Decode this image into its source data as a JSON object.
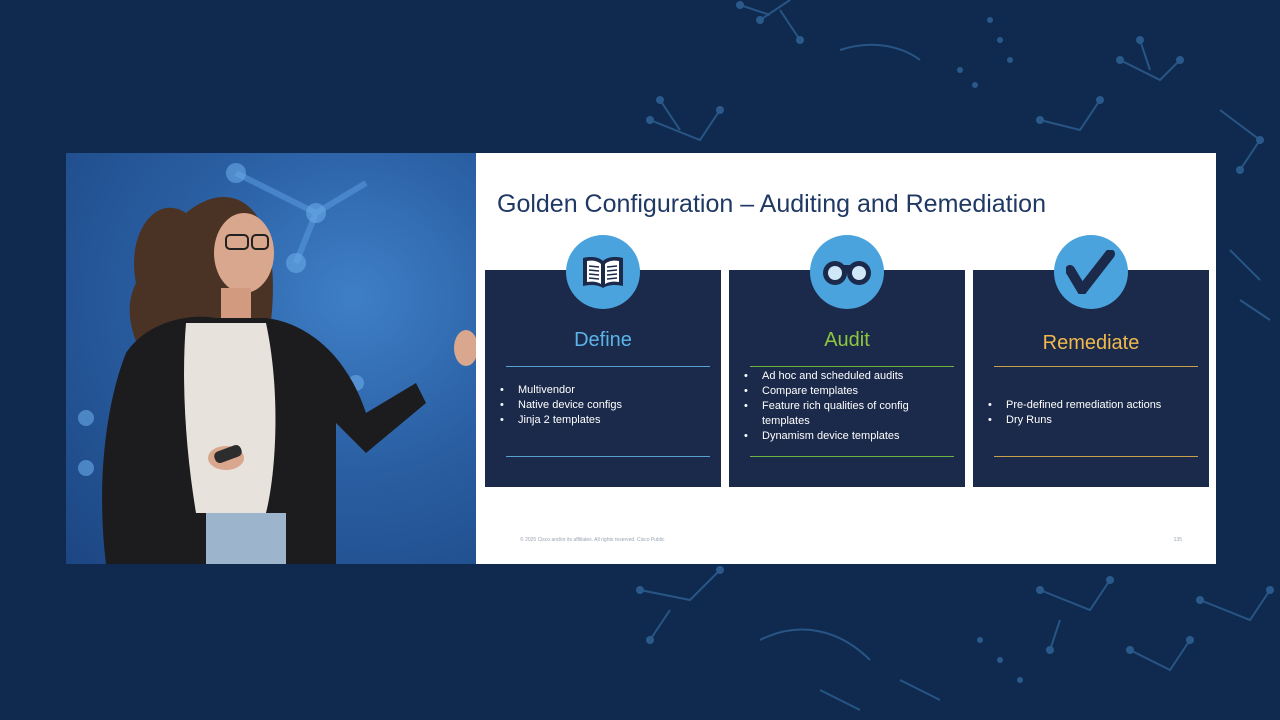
{
  "slide": {
    "title": "Golden Configuration – Auditing and Remediation",
    "footer": "© 2025 Cisco and/or its affiliates. All rights reserved. Cisco Public",
    "page_number": "135",
    "cards": [
      {
        "icon": "book-icon",
        "title": "Define",
        "title_color": "#5bb4e8",
        "rule_color": "#5a9fd4",
        "items": [
          "Multivendor",
          "Native device configs",
          "Jinja 2 templates"
        ]
      },
      {
        "icon": "binoculars-icon",
        "title": "Audit",
        "title_color": "#8dc63f",
        "rule_color": "#6cb33f",
        "items": [
          "Ad hoc and scheduled audits",
          "Compare templates",
          "Feature rich qualities of config templates",
          " Dynamism device templates"
        ]
      },
      {
        "icon": "checkmark-icon",
        "title": "Remediate",
        "title_color": "#f0b94d",
        "rule_color": "#c9a04a",
        "items": [
          "Pre-defined remediation actions",
          "Dry Runs"
        ]
      }
    ]
  },
  "colors": {
    "background": "#0f2a4e",
    "card_background": "#1b2a4a",
    "icon_circle": "#4ba3dd",
    "title_text": "#1f3864"
  }
}
